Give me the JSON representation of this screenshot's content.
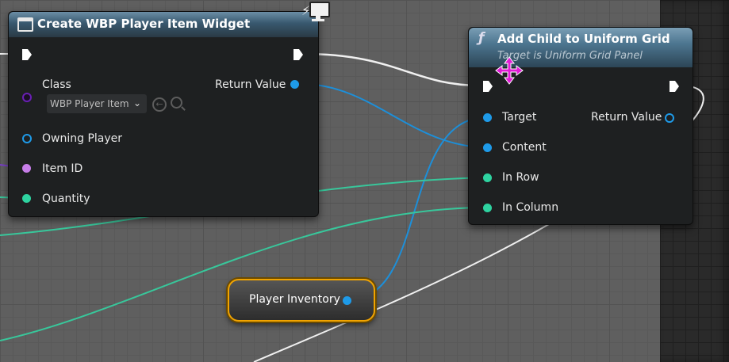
{
  "colors": {
    "exec": "#ffffff",
    "object": "#1e9ae8",
    "class": "#6a1fb5",
    "int": "#c77ee8",
    "intTeal": "#2ed3a0",
    "wireTeal": "#38c79b",
    "wireBlue": "#1d8fd9",
    "wireWhite": "#f0f0f0",
    "wirePurple": "#7a3fc8"
  },
  "create_node": {
    "title": "Create WBP Player Item Widget",
    "class_label": "Class",
    "class_value": "WBP Player Item",
    "return_label": "Return Value",
    "owning_label": "Owning Player",
    "itemid_label": "Item ID",
    "quantity_label": "Quantity"
  },
  "add_node": {
    "title": "Add Child to Uniform Grid",
    "subtitle": "Target is Uniform Grid Panel",
    "target_label": "Target",
    "content_label": "Content",
    "row_label": "In Row",
    "column_label": "In Column",
    "return_label": "Return Value"
  },
  "variable_node": {
    "label": "Player Inventory"
  }
}
